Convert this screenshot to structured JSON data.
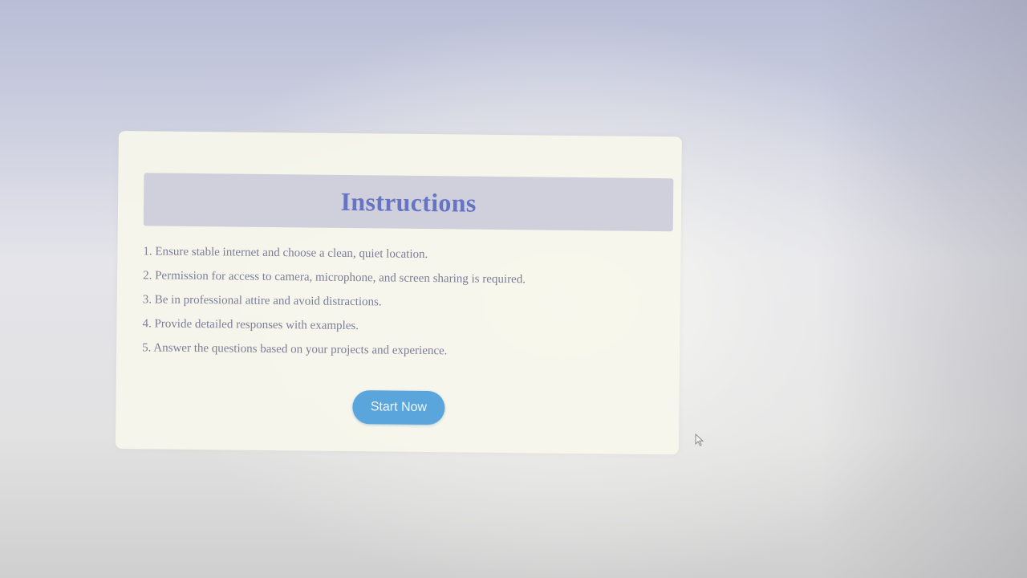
{
  "dialog": {
    "title": "Instructions",
    "items": [
      "1. Ensure stable internet and choose a clean, quiet location.",
      "2. Permission for access to camera, microphone, and screen sharing is required.",
      "3. Be in professional attire and avoid distractions.",
      "4. Provide detailed responses with examples.",
      "5. Answer the questions based on your projects and experience."
    ],
    "start_button_label": "Start Now"
  },
  "colors": {
    "title": "#6674c4",
    "header_background": "#d0d0dc",
    "text": "#7c7e98",
    "button": "#5aa6dc",
    "card_background": "#f6f6ec"
  },
  "icons": {
    "pointer": "mouse-pointer-icon"
  }
}
